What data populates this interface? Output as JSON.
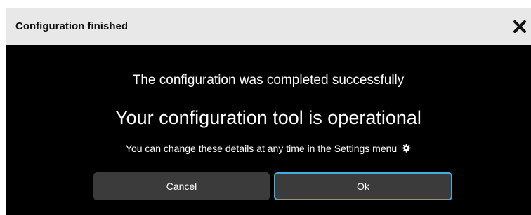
{
  "dialog": {
    "title": "Configuration finished",
    "close_icon": "close-icon",
    "message_primary": "The configuration was completed successfully",
    "message_secondary": "Your configuration tool is operational",
    "message_hint": "You can change these details at any time in the Settings menu",
    "hint_icon": "gear-icon",
    "buttons": {
      "cancel_label": "Cancel",
      "ok_label": "Ok"
    },
    "colors": {
      "titlebar_bg": "#e8e8e8",
      "body_bg": "#000000",
      "button_bg": "#3b3b3b",
      "ok_border": "#36b1e6",
      "text": "#ffffff"
    }
  }
}
